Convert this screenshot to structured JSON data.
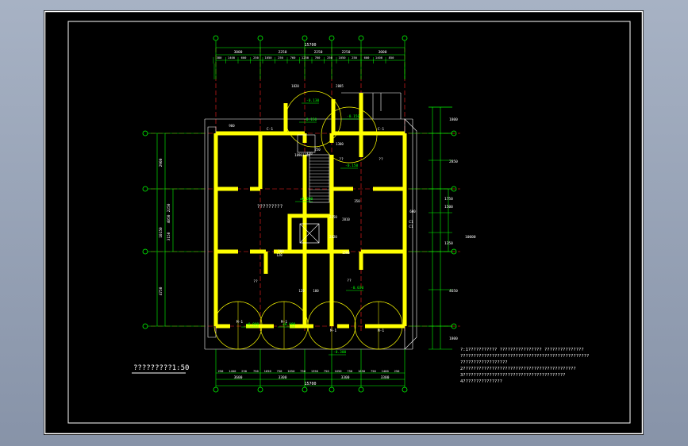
{
  "colors": {
    "background": "#000000",
    "frame": "#ffffff",
    "wall": "#ffff00",
    "dim": "#00ff00",
    "axis": "#ff2020",
    "text": "#ffffff",
    "level": "#00ff00",
    "viewport": "#a7b2c4"
  },
  "drawing": {
    "title": "?????????1:50",
    "top_total": "15700",
    "top_row1": [
      "3000",
      "2250",
      "2250",
      "2250",
      "3000"
    ],
    "top_row2": [
      "380",
      "1400",
      "600",
      "250",
      "1050",
      "250",
      "760",
      "1250",
      "760",
      "250",
      "1050",
      "250",
      "600",
      "1400",
      "850"
    ],
    "bottom_total": "15700",
    "bottom_row1": [
      "3600",
      "3300",
      "3300",
      "3300"
    ],
    "bottom_row2": [
      "250",
      "1400",
      "250",
      "750",
      "1650",
      "750",
      "1650",
      "750",
      "1350",
      "750",
      "1650",
      "750",
      "1650",
      "750",
      "1400",
      "250"
    ],
    "left_dims": [
      "2900",
      "2250",
      "4050",
      "10150",
      "3150",
      "4750"
    ],
    "right_dims": [
      "1800",
      "2850",
      "1750",
      "1500",
      "10000",
      "1350",
      "4650",
      "1800"
    ],
    "inner_dims": [
      "900",
      "120",
      "1180",
      "250",
      "1300",
      "2820",
      "2250",
      "600",
      "2010",
      "200",
      "350",
      "120",
      "100",
      "120",
      "1820",
      "2885",
      "1890",
      "1500"
    ],
    "levels": [
      "-0.130",
      "-0.150",
      "-0.150",
      "-0.150",
      "±0.000",
      "-0.030",
      "±0.000",
      "±0.000",
      "-0.300"
    ],
    "room_labels": [
      "?????????",
      "??",
      "??",
      "??",
      "??",
      "M-1",
      "M-1",
      "M-1",
      "M-1",
      "C-1",
      "C-1",
      "C1",
      "C1"
    ],
    "notes": [
      "?:1???????????  ????????????????  ???????????????",
      "  ?????????????????????????????????????????????????",
      "  ??????????????????",
      "2???????????????????????????????????????????",
      "3???????????????????????????????????????",
      "4???????????????"
    ]
  }
}
